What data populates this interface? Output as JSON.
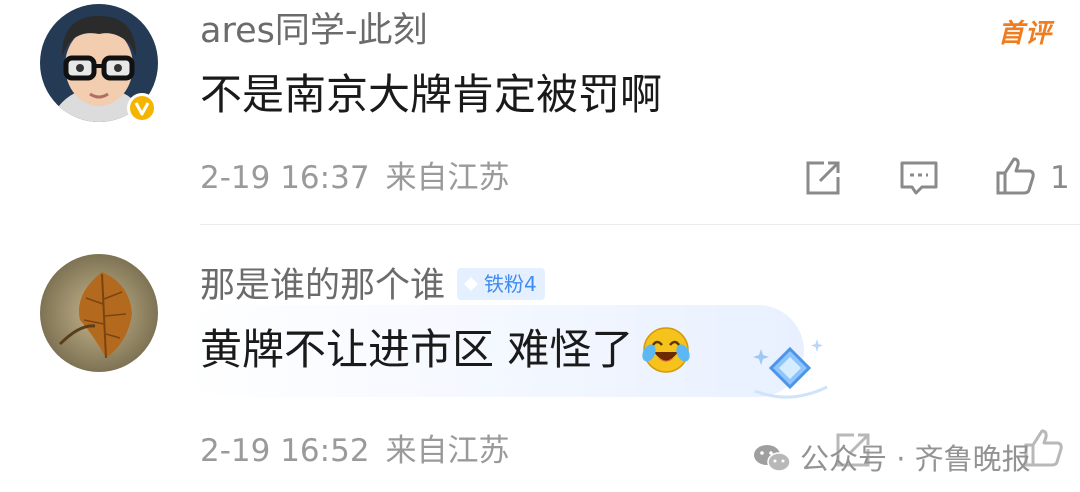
{
  "comments": [
    {
      "username": "ares同学-此刻",
      "text": "不是南京大牌肯定被罚啊",
      "time": "2-19 16:37",
      "location": "来自江苏",
      "badge": "首评",
      "like_count": "1",
      "avatar_icon": "memoji-avatar",
      "verified_icon": "verified-v-badge",
      "accent": "#f07c20"
    },
    {
      "username": "那是谁的那个谁",
      "fan_badge": "铁粉4",
      "text": "黄牌不让进市区 难怪了",
      "time": "2-19 16:52",
      "location": "来自江苏",
      "emoji": "laughing-crying-emoji",
      "avatar_icon": "autumn-leaf-avatar",
      "accent": "#3f8cf0"
    }
  ],
  "watermark": {
    "text": "公众号 · 齐鲁晚报",
    "icon": "wechat-icon"
  }
}
